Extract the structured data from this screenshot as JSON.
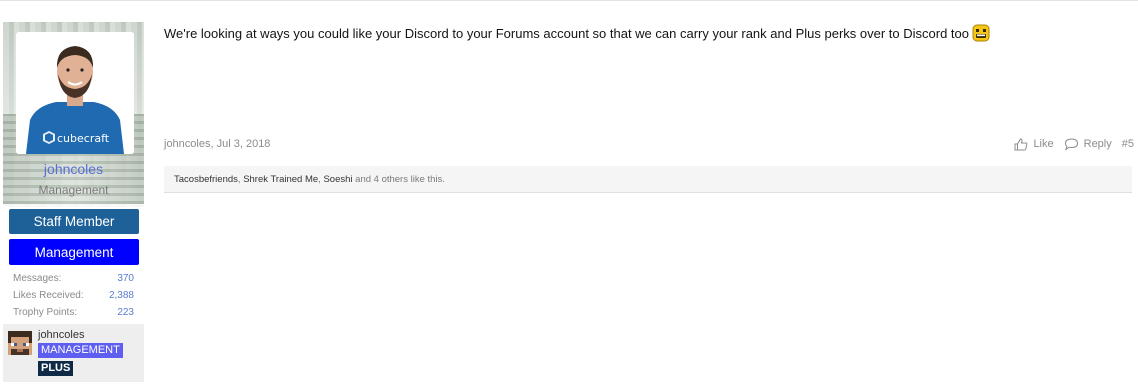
{
  "user": {
    "name": "johncoles",
    "title": "Management",
    "avatar_shirt_text": "cubecraft",
    "banners": {
      "staff": "Staff Member",
      "management": "Management"
    },
    "stats": [
      {
        "label": "Messages:",
        "value": "370"
      },
      {
        "label": "Likes Received:",
        "value": "2,388"
      },
      {
        "label": "Trophy Points:",
        "value": "223"
      }
    ],
    "minecraft": {
      "name": "johncoles",
      "rank": "MANAGEMENT",
      "plus": "PLUS"
    }
  },
  "post": {
    "text": "We're looking at ways you could like your Discord to your Forums account so that we can carry your rank and Plus perks over to Discord too",
    "emoji": "grinning-face",
    "author": "johncoles",
    "date": "Jul 3, 2018",
    "actions": {
      "like": "Like",
      "reply": "Reply",
      "permalink": "#5"
    },
    "likes": {
      "likers": [
        "Tacosbefriends",
        "Shrek Trained Me",
        "Soeshi"
      ],
      "separator": ", ",
      "others_text": "and 4 others like this."
    }
  },
  "colors": {
    "staff_banner": "#1e6199",
    "management_banner": "#0000ff",
    "rank_badge": "#5e5ef0",
    "plus_badge": "#0e2a47",
    "link": "#5a6fd6"
  }
}
